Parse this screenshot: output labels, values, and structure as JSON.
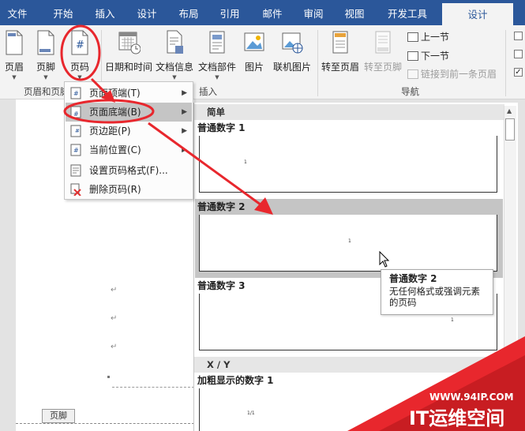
{
  "tabs": [
    "文件",
    "开始",
    "插入",
    "设计",
    "布局",
    "引用",
    "邮件",
    "审阅",
    "视图",
    "开发工具",
    "设计"
  ],
  "ribbon": {
    "header": "页眉",
    "footer": "页脚",
    "page_number": "页码",
    "datetime": "日期和时间",
    "docinfo": "文档信息",
    "docparts": "文档部件",
    "picture": "图片",
    "online_picture": "联机图片",
    "goto_header": "转至页眉",
    "goto_footer": "转至页脚",
    "prev_section": "上一节",
    "next_section": "下一节",
    "link_prev": "链接到前一条页眉",
    "group_header_footer": "页眉和页脚",
    "group_insert": "插入",
    "group_nav": "导航"
  },
  "menu": [
    {
      "label": "页面顶端(T)",
      "submenu": true
    },
    {
      "label": "页面底端(B)",
      "submenu": true
    },
    {
      "label": "页边距(P)",
      "submenu": true
    },
    {
      "label": "当前位置(C)",
      "submenu": true
    },
    {
      "label": "设置页码格式(F)...",
      "submenu": false
    },
    {
      "label": "删除页码(R)",
      "submenu": false
    }
  ],
  "gallery": {
    "section1": "简单",
    "item1": "普通数字 1",
    "item2": "普通数字 2",
    "item3": "普通数字 3",
    "section2": "X / Y",
    "item4": "加粗显示的数字 1",
    "sample_num": "1",
    "sample_bold": "1/1"
  },
  "tooltip": {
    "title": "普通数字 2",
    "desc": "无任何格式或强调元素的页码"
  },
  "document": {
    "footer_tag": "页脚",
    "para_mark": "↵"
  },
  "watermark": {
    "url": "WWW.94IP.COM",
    "brand": "IT运维空间"
  },
  "colors": {
    "word_blue": "#2b579a",
    "annotation_red": "#e8272d",
    "highlight": "#c5c5c5"
  }
}
